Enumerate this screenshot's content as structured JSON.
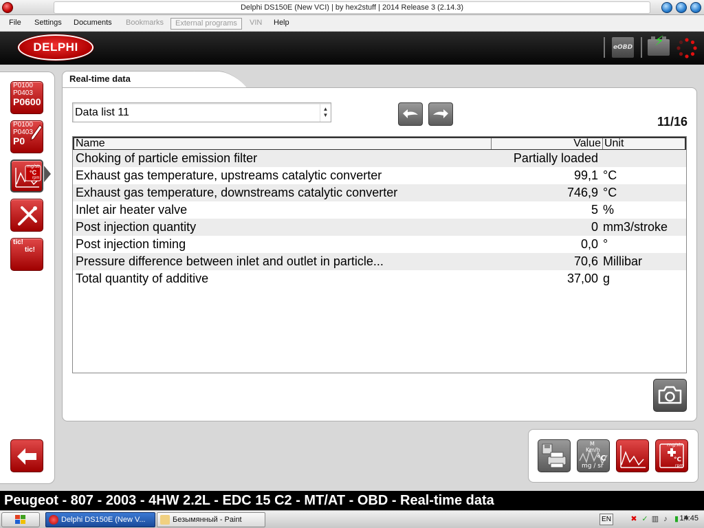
{
  "window": {
    "title": "Delphi DS150E (New VCI) | by hex2stuff | 2014 Release 3 (2.14.3)"
  },
  "menu": {
    "items": [
      {
        "label": "File",
        "enabled": true
      },
      {
        "label": "Settings",
        "enabled": true
      },
      {
        "label": "Documents",
        "enabled": true
      },
      {
        "label": "Bookmarks",
        "enabled": false
      },
      {
        "label": "External programs",
        "enabled": false
      },
      {
        "label": "VIN",
        "enabled": false
      },
      {
        "label": "Help",
        "enabled": true
      }
    ]
  },
  "header": {
    "logo_text": "DELPHI",
    "eobd_label": "eOBD"
  },
  "sidebar": {
    "dtc_read_lines": [
      "P0100",
      "P0403",
      "P0600"
    ],
    "dtc_clear_lines": [
      "P0100",
      "P0403",
      "P0"
    ],
    "realtime_lines": [
      "mg/str",
      "°C",
      "rpm"
    ],
    "tic_lines": [
      "tic!",
      "tic!"
    ]
  },
  "panel": {
    "tab_title": "Real-time data",
    "data_list_selected": "Data list 11",
    "page_counter": "11/16"
  },
  "table": {
    "columns": {
      "name": "Name",
      "value": "Value",
      "unit": "Unit"
    },
    "rows": [
      {
        "name": "Choking of particle emission filter",
        "value": "Partially loaded",
        "unit": ""
      },
      {
        "name": "Exhaust gas temperature, upstreams catalytic converter",
        "value": "99,1",
        "unit": "°C"
      },
      {
        "name": "Exhaust gas temperature, downstreams catalytic converter",
        "value": "746,9",
        "unit": "°C"
      },
      {
        "name": "Inlet air heater valve",
        "value": "5",
        "unit": "%"
      },
      {
        "name": "Post injection quantity",
        "value": "0",
        "unit": "mm3/stroke"
      },
      {
        "name": "Post injection timing",
        "value": "0,0",
        "unit": "°"
      },
      {
        "name": "Pressure difference between inlet and outlet in particle...",
        "value": "70,6",
        "unit": "Millibar"
      },
      {
        "name": "Total quantity of additive",
        "value": "37,00",
        "unit": "g"
      }
    ]
  },
  "toolbar": {
    "gauge_lines": [
      "M",
      "Km/h",
      "°C",
      "mg / sr"
    ],
    "realtime_lines": [
      "mg/str",
      "°C",
      "rpm"
    ]
  },
  "infobar": {
    "text": "Peugeot - 807 - 2003 - 4HW 2.2L - EDC 15 C2 - MT/AT - OBD - Real-time data"
  },
  "taskbar": {
    "tasks": [
      {
        "label": "Delphi DS150E (New V...",
        "active": true
      },
      {
        "label": "Безымянный - Paint",
        "active": false
      }
    ],
    "language": "EN",
    "clock": "14:45"
  },
  "colors": {
    "brand_red": "#c00000",
    "header_black": "#050505",
    "taskbar_active": "#1a4a9a"
  }
}
